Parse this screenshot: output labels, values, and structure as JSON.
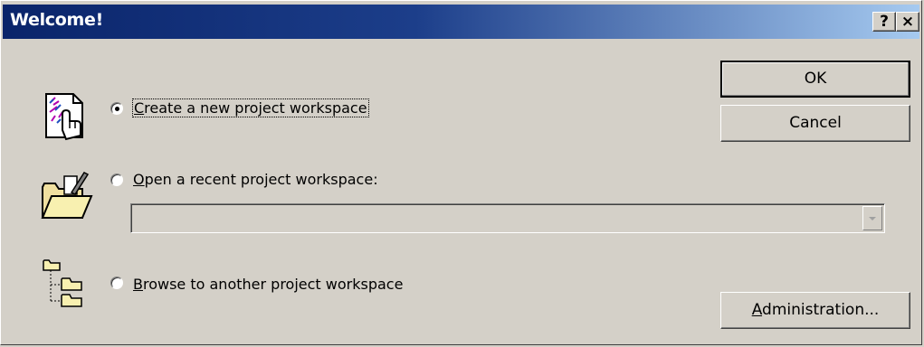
{
  "window": {
    "title": "Welcome!",
    "help_label": "?",
    "close_label": "×"
  },
  "options": [
    {
      "label": "Create a new project workspace",
      "mnemonic": "C",
      "rest": "reate a new project workspace",
      "selected": true,
      "icon": "new-project-icon"
    },
    {
      "label": "Open a recent project workspace:",
      "mnemonic": "O",
      "rest": "pen a recent project workspace:",
      "selected": false,
      "icon": "open-folder-icon"
    },
    {
      "label": "Browse to another project workspace",
      "mnemonic": "B",
      "rest": "rowse to another project workspace",
      "selected": false,
      "icon": "folder-tree-icon"
    }
  ],
  "recent_combo": {
    "value": "",
    "enabled": false
  },
  "buttons": {
    "ok": "OK",
    "cancel": "Cancel",
    "admin_mnemonic": "A",
    "admin_rest": "dministration..."
  },
  "colors": {
    "dialog_bg": "#d4d0c8",
    "titlebar_start": "#0a246a",
    "titlebar_end": "#a6caf0"
  }
}
